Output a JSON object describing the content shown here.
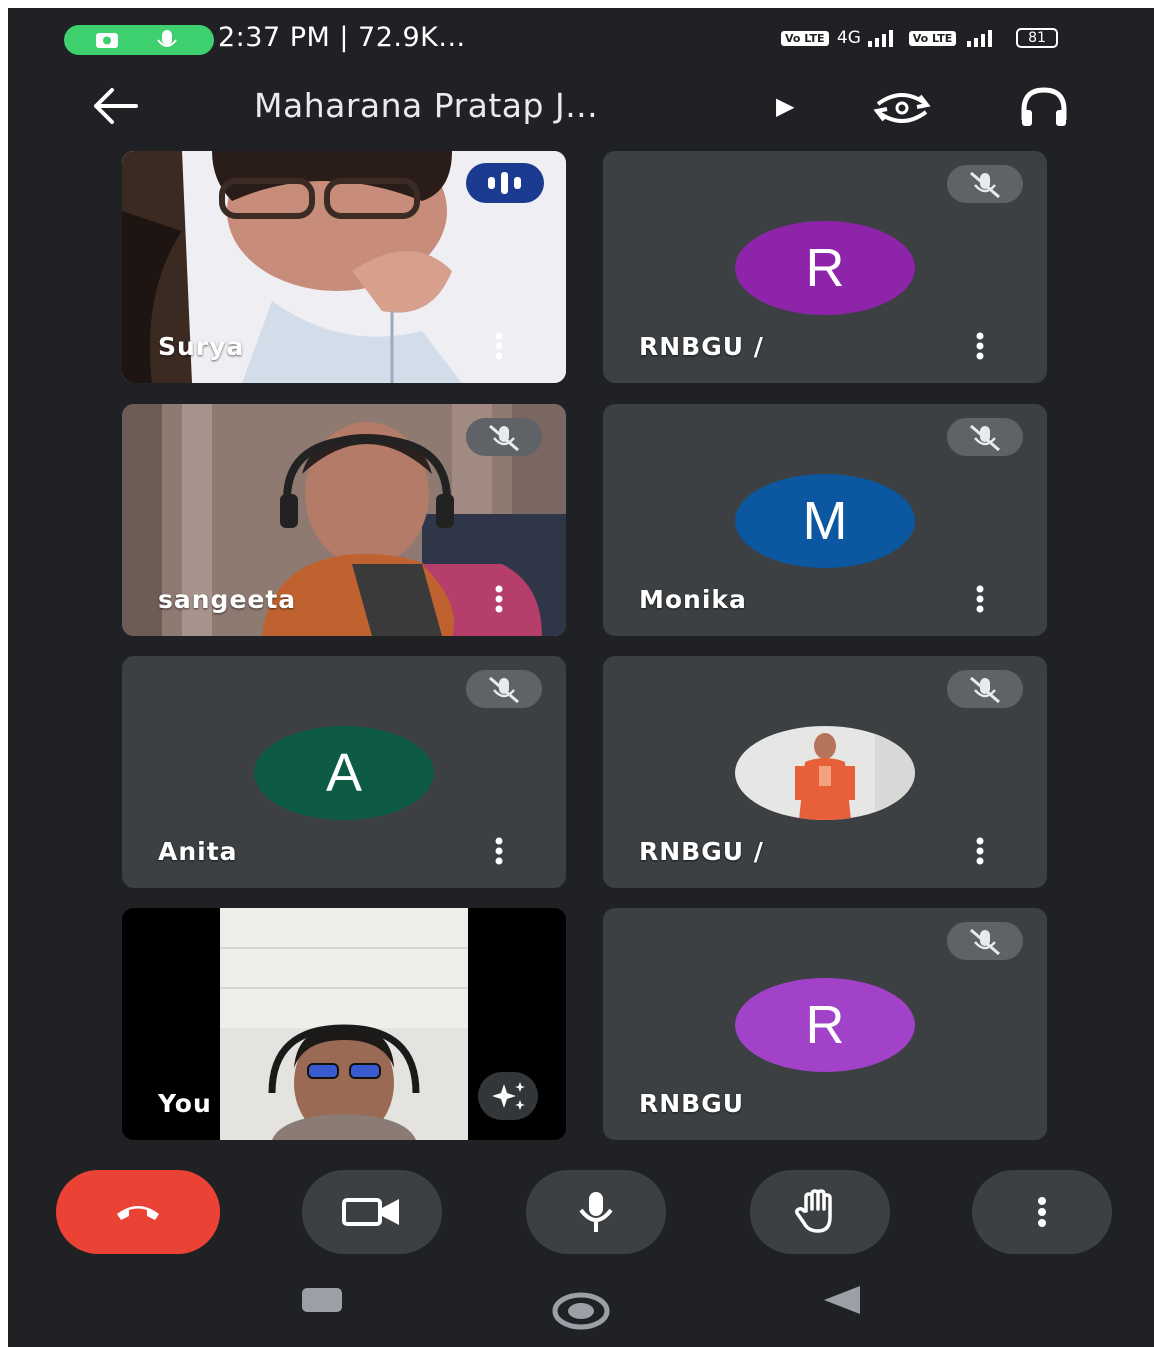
{
  "status_bar": {
    "time_info": "2:37 PM | 72.9K...",
    "network_1": "4G",
    "lte_label": "Vo LTE",
    "battery": "81"
  },
  "header": {
    "title": "Maharana Pratap J...",
    "back_icon": "arrow-left-icon",
    "switch_camera_icon": "switch-camera-icon",
    "audio_icon": "headphones-icon"
  },
  "participants": [
    {
      "name": "Surya",
      "type": "video",
      "speaking": true
    },
    {
      "name": "RNBGU /",
      "type": "avatar",
      "initial": "R",
      "color": "#8e24aa",
      "muted": true
    },
    {
      "name": "sangeeta",
      "type": "video",
      "muted": true
    },
    {
      "name": "Monika",
      "type": "avatar",
      "initial": "M",
      "color": "#0b57a0",
      "muted": true
    },
    {
      "name": "Anita",
      "type": "avatar",
      "initial": "A",
      "color": "#0d5a45",
      "muted": true
    },
    {
      "name": "RNBGU /",
      "type": "photo",
      "muted": true
    },
    {
      "name": "You",
      "type": "self-video",
      "effects_icon": "sparkle-icon"
    },
    {
      "name": "RNBGU",
      "type": "avatar",
      "initial": "R",
      "color": "#a142c8",
      "muted": true
    }
  ],
  "controls": {
    "end_call_icon": "phone-hangup-icon",
    "camera_icon": "video-camera-icon",
    "mic_icon": "microphone-icon",
    "raise_hand_icon": "hand-icon",
    "more_icon": "more-vert-icon",
    "end_call_color": "#ea4335"
  },
  "nav_bar": {
    "recents_icon": "square-icon",
    "home_icon": "circle-icon",
    "back_icon": "triangle-back-icon"
  }
}
